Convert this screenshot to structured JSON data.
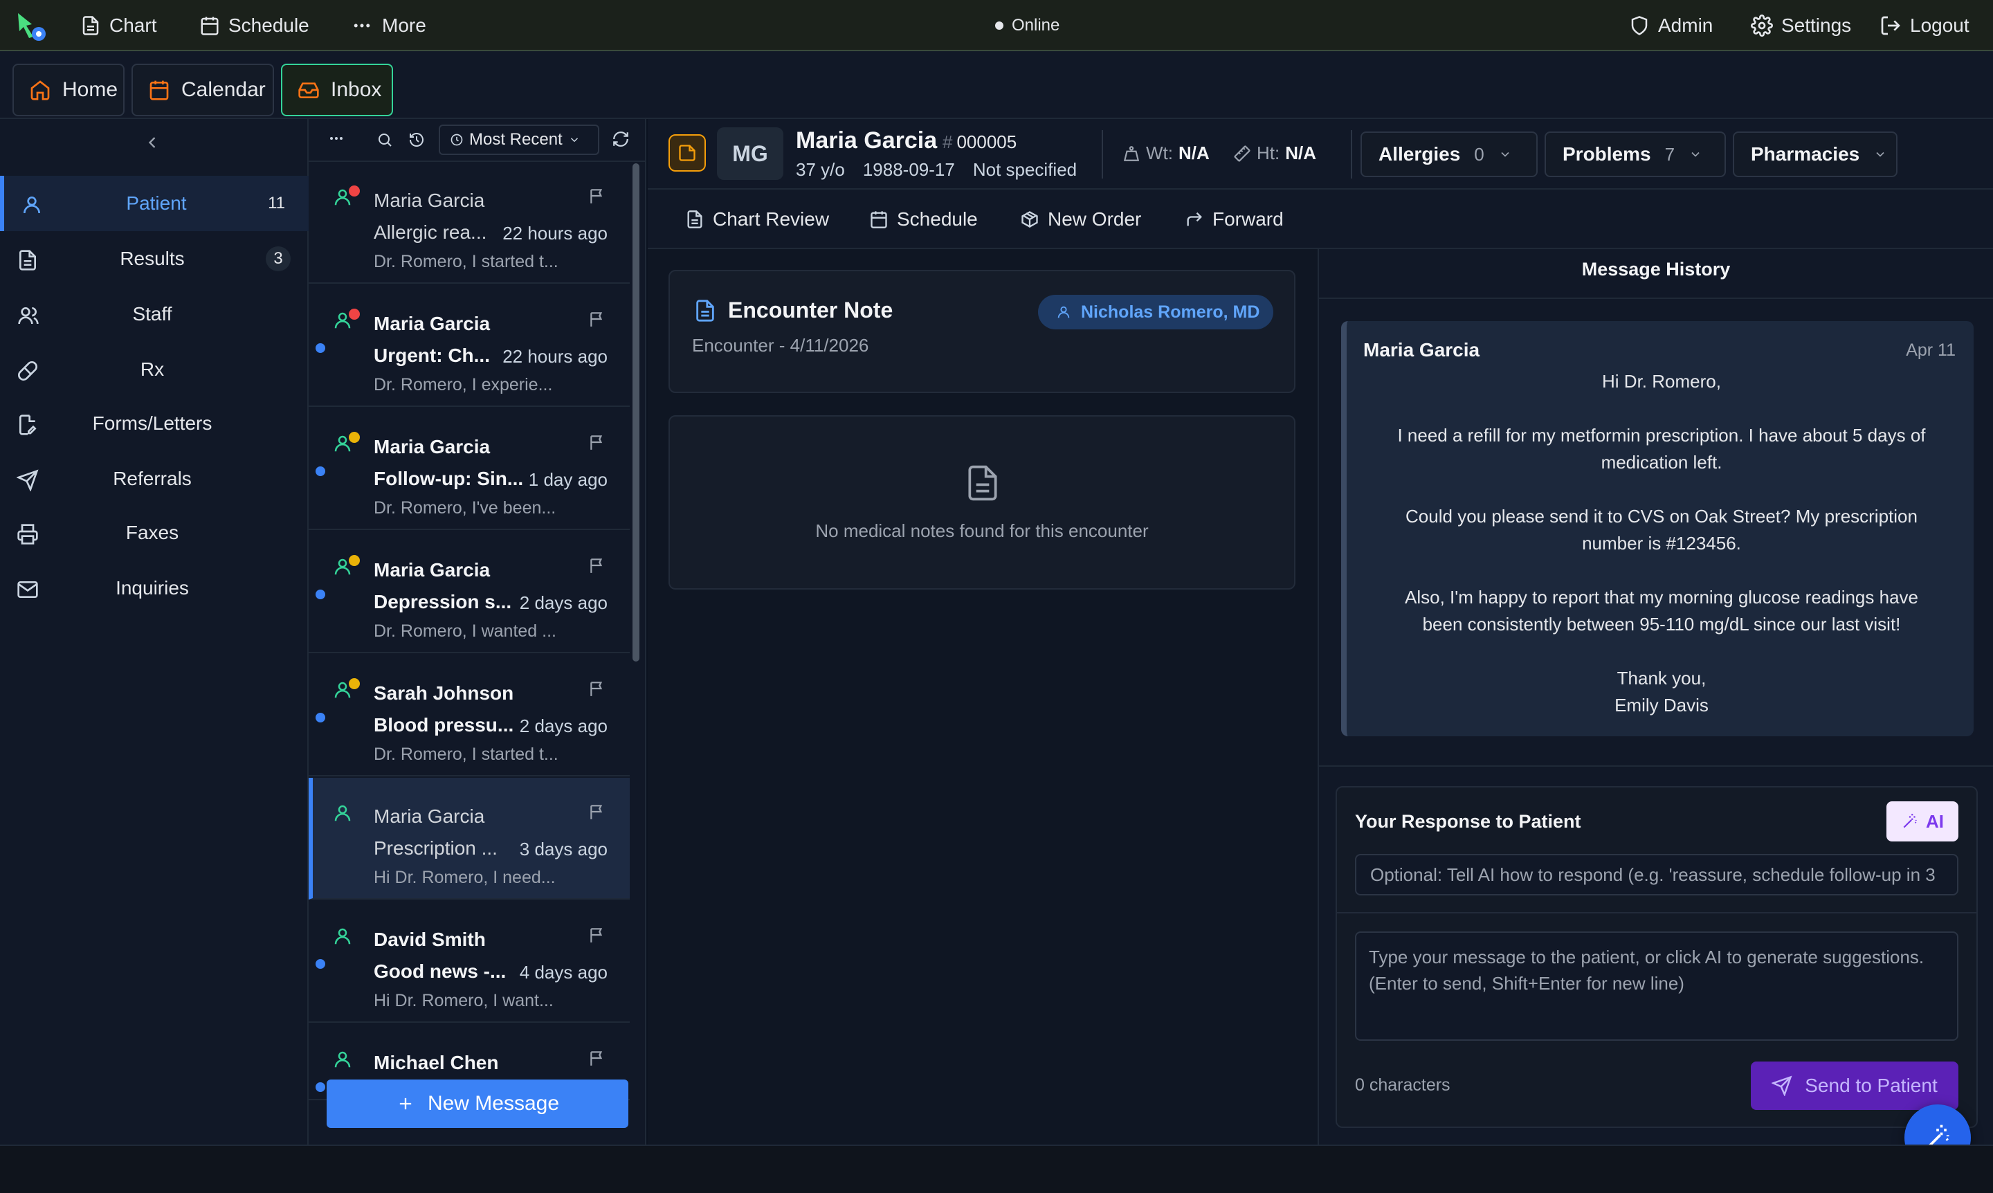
{
  "topbar": {
    "chart": "Chart",
    "schedule": "Schedule",
    "more": "More",
    "status": "Online",
    "admin": "Admin",
    "settings": "Settings",
    "logout": "Logout"
  },
  "tabs": {
    "home": "Home",
    "calendar": "Calendar",
    "inbox": "Inbox"
  },
  "sidebar": {
    "items": [
      {
        "label": "Patient",
        "badge": "11"
      },
      {
        "label": "Results",
        "badge": "3"
      },
      {
        "label": "Staff"
      },
      {
        "label": "Rx"
      },
      {
        "label": "Forms/Letters"
      },
      {
        "label": "Referrals"
      },
      {
        "label": "Faxes"
      },
      {
        "label": "Inquiries"
      }
    ]
  },
  "msglist": {
    "sort": "Most Recent",
    "new_message": "New Message",
    "items": [
      {
        "name": "Maria Garcia",
        "subject": "Allergic rea...",
        "time": "22 hours ago",
        "preview": "Dr. Romero, I started t...",
        "status": "#ef4444",
        "unread": false
      },
      {
        "name": "Maria Garcia",
        "subject": "Urgent: Ch...",
        "time": "22 hours ago",
        "preview": "Dr. Romero, I experie...",
        "status": "#ef4444",
        "unread": true
      },
      {
        "name": "Maria Garcia",
        "subject": "Follow-up: Sin...",
        "time": "1 day ago",
        "preview": "Dr. Romero, I've been...",
        "status": "#eab308",
        "unread": true
      },
      {
        "name": "Maria Garcia",
        "subject": "Depression s...",
        "time": "2 days ago",
        "preview": "Dr. Romero, I wanted ...",
        "status": "#eab308",
        "unread": true
      },
      {
        "name": "Sarah Johnson",
        "subject": "Blood pressu...",
        "time": "2 days ago",
        "preview": "Dr. Romero, I started t...",
        "status": "#eab308",
        "unread": true
      },
      {
        "name": "Maria Garcia",
        "subject": "Prescription ...",
        "time": "3 days ago",
        "preview": "Hi Dr. Romero, I need...",
        "status": "",
        "unread": false,
        "selected": true
      },
      {
        "name": "David Smith",
        "subject": "Good news -...",
        "time": "4 days ago",
        "preview": "Hi Dr. Romero, I want...",
        "status": "",
        "unread": true
      },
      {
        "name": "Michael Chen",
        "subject": "",
        "time": "",
        "preview": "",
        "status": "",
        "unread": true
      }
    ]
  },
  "patient": {
    "initials": "MG",
    "name": "Maria Garcia",
    "mrn": "000005",
    "age": "37 y/o",
    "dob": "1988-09-17",
    "sex": "Not specified",
    "wt_label": "Wt:",
    "wt": "N/A",
    "ht_label": "Ht:",
    "ht": "N/A",
    "allergies": "Allergies",
    "allergies_count": "0",
    "problems": "Problems",
    "problems_count": "7",
    "pharmacies": "Pharmacies"
  },
  "actions": {
    "chart_review": "Chart Review",
    "schedule": "Schedule",
    "new_order": "New Order",
    "forward": "Forward"
  },
  "encounter": {
    "title": "Encounter Note",
    "provider": "Nicholas Romero, MD",
    "date": "Encounter - 4/11/2026",
    "empty": "No medical notes found for this encounter"
  },
  "history": {
    "title": "Message History",
    "sender": "Maria Garcia",
    "date": "Apr 11",
    "lines": [
      "Hi Dr. Romero,",
      "",
      "I need a refill for my metformin prescription. I have about 5 days of",
      "medication left.",
      "",
      "Could you please send it to CVS on Oak Street? My prescription",
      "number is #123456.",
      "",
      "Also, I'm happy to report that my morning glucose readings have",
      "been consistently between 95-110 mg/dL since our last visit!",
      "",
      "Thank you,",
      "Emily Davis"
    ]
  },
  "response": {
    "title": "Your Response to Patient",
    "ai": "AI",
    "hint_placeholder": "Optional: Tell AI how to respond (e.g. 'reassure, schedule follow-up in 3",
    "message_placeholder": "Type your message to the patient, or click AI to generate suggestions. (Enter to send, Shift+Enter for new line)",
    "chars": "0 characters",
    "send": "Send to Patient"
  },
  "colors": {
    "accent": "#3b82f6",
    "success": "#34d399",
    "purple": "#7c3aed",
    "warning": "#f59e0b"
  }
}
